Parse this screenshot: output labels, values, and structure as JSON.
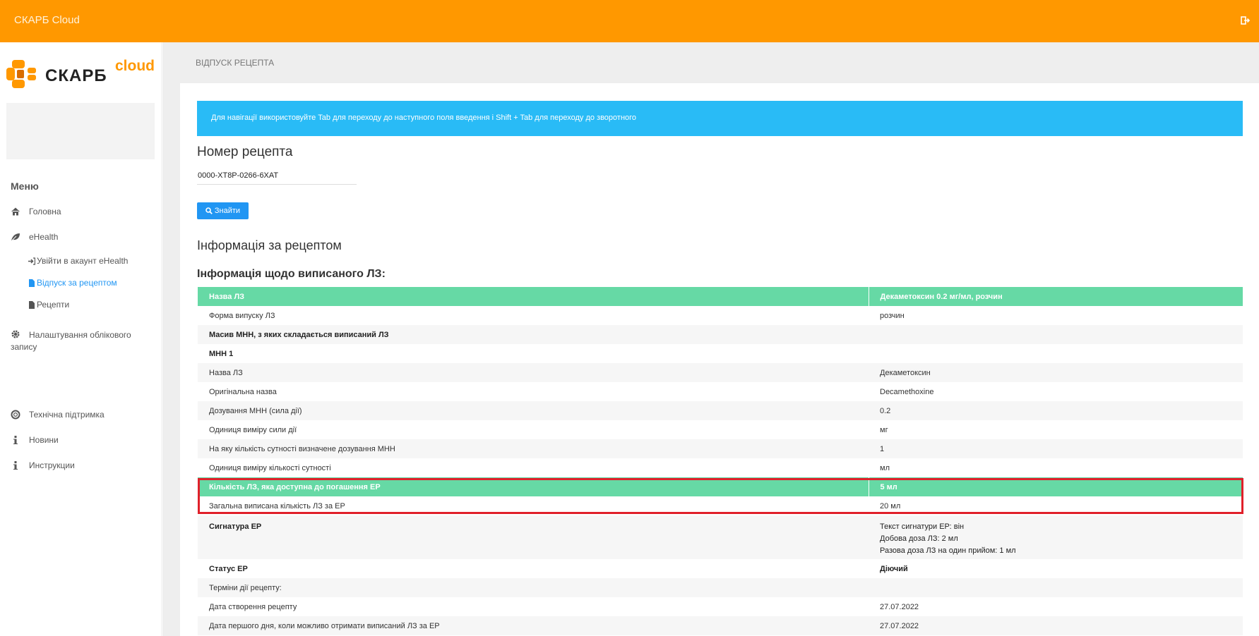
{
  "header": {
    "app_title": "СКАРБ Cloud"
  },
  "sidebar": {
    "logo_word": "СКАРБ",
    "logo_suffix": "cloud",
    "menu_title": "Меню",
    "items": {
      "home": "Головна",
      "ehealth": "eHealth",
      "ehealth_login": "Увійти в акаунт eHealth",
      "dispense": "Відпуск за рецептом",
      "recipes": "Рецепти",
      "account_settings": "Налаштування облікового запису",
      "support": "Технічна підтримка",
      "news": "Новини",
      "instructions": "Инструкции"
    }
  },
  "page": {
    "breadcrumb": "ВІДПУСК РЕЦЕПТА",
    "alert": "Для навігації використовуйте Tab для переходу до наступного поля введення і Shift + Tab для переходу до зворотного",
    "recipe_number_title": "Номер рецепта",
    "recipe_number_value": "0000-XT8P-0266-6XAT",
    "find_label": "Знайти",
    "info_title": "Інформація за рецептом",
    "drug_info_title": "Інформація щодо виписаного ЛЗ:"
  },
  "table": {
    "rows": [
      {
        "label": "Назва ЛЗ",
        "value": "Декаметоксин 0.2 мг/мл, розчин"
      },
      {
        "label": "Форма випуску ЛЗ",
        "value": "розчин"
      },
      {
        "label": "Масив МНН, з яких складається виписаний ЛЗ",
        "value": ""
      },
      {
        "label": "МНН 1",
        "value": ""
      },
      {
        "label": "Назва ЛЗ",
        "value": "Декаметоксин"
      },
      {
        "label": "Оригінальна назва",
        "value": "Decamethoxine"
      },
      {
        "label": "Дозування МНН (сила дії)",
        "value": "0.2"
      },
      {
        "label": "Одиниця виміру сили дії",
        "value": "мг"
      },
      {
        "label": "На яку кількість сутності визначене дозування МНН",
        "value": "1"
      },
      {
        "label": "Одиниця виміру кількості сутності",
        "value": "мл"
      },
      {
        "label": "Кількість ЛЗ, яка доступна до погашення ЕР",
        "value": "5 мл"
      },
      {
        "label": "Загальна виписана кількість ЛЗ за ЕР",
        "value": "20 мл"
      },
      {
        "label": "Сигнатура ЕР",
        "value_lines": [
          "Текст сигнатури ЕР: він",
          "Добова доза ЛЗ: 2 мл",
          "Разова доза ЛЗ на один прийом: 1 мл"
        ]
      },
      {
        "label": "Статус ЕР",
        "value": "Діючий"
      },
      {
        "label": "Терміни дії рецепту:",
        "value": ""
      },
      {
        "label": "Дата створення рецепту",
        "value": "27.07.2022"
      },
      {
        "label": "Дата першого дня, коли можливо отримати виписаний ЛЗ за ЕР",
        "value": "27.07.2022"
      }
    ]
  },
  "colors": {
    "topbar": "#ff9800",
    "accent": "#2196f3",
    "alert": "#29bbf6",
    "table_head": "#66d9a5",
    "highlight": "#e0202a"
  }
}
